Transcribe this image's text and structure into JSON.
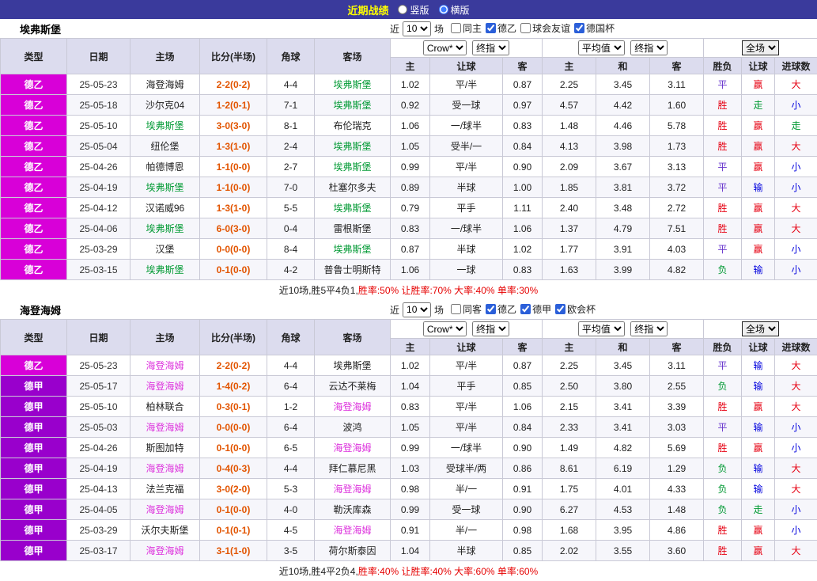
{
  "colors": {
    "accent_bar": "#3a3a9c",
    "title_text": "#ffff00",
    "header_bg": "#dcdcee",
    "score": "#e25400",
    "summary_stats": "#e60000",
    "league": {
      "德乙": "#d800d8",
      "德甲": "#9900cc"
    },
    "outcome": {
      "胜": "#e60012",
      "平": "#6633cc",
      "负": "#009933"
    },
    "handicap": {
      "赢": "#e60012",
      "输": "#0000dd",
      "走": "#009933"
    },
    "goals": {
      "大": "#e60012",
      "小": "#0000dd",
      "走": "#009933"
    }
  },
  "top_bar": {
    "title": "近期战绩",
    "radios": [
      {
        "label": "竖版",
        "checked": false
      },
      {
        "label": "横版",
        "checked": true
      }
    ]
  },
  "filter": {
    "near": "近",
    "count": "10",
    "games": "场"
  },
  "table_header": {
    "type": "类型",
    "date": "日期",
    "home": "主场",
    "score": "比分(半场)",
    "corner": "角球",
    "away": "客场",
    "odds1_selects": [
      "Crow*",
      "终指"
    ],
    "odds2_selects": [
      "平均值",
      "终指"
    ],
    "odds3_select": "全场",
    "sub1": [
      "主",
      "让球",
      "客"
    ],
    "sub2": [
      "主",
      "和",
      "客"
    ],
    "sub3": [
      "胜负",
      "让球",
      "进球数"
    ]
  },
  "sections": [
    {
      "team": "埃弗斯堡",
      "focus_color": "#009933",
      "checkboxes": [
        {
          "label": "同主",
          "checked": false
        },
        {
          "label": "德乙",
          "checked": true
        },
        {
          "label": "球会友谊",
          "checked": false
        },
        {
          "label": "德国杯",
          "checked": true
        }
      ],
      "rows": [
        {
          "league": "德乙",
          "date": "25-05-23",
          "home": "海登海姆",
          "score": "2-2(0-2)",
          "corner": "4-4",
          "away": "埃弗斯堡",
          "o1": [
            "1.02",
            "平/半",
            "0.87"
          ],
          "o2": [
            "2.25",
            "3.45",
            "3.11"
          ],
          "res": [
            "平",
            "赢",
            "大"
          ]
        },
        {
          "league": "德乙",
          "date": "25-05-18",
          "home": "沙尔克04",
          "score": "1-2(0-1)",
          "corner": "7-1",
          "away": "埃弗斯堡",
          "o1": [
            "0.92",
            "受一球",
            "0.97"
          ],
          "o2": [
            "4.57",
            "4.42",
            "1.60"
          ],
          "res": [
            "胜",
            "走",
            "小"
          ]
        },
        {
          "league": "德乙",
          "date": "25-05-10",
          "home": "埃弗斯堡",
          "score": "3-0(3-0)",
          "corner": "8-1",
          "away": "布伦瑞克",
          "o1": [
            "1.06",
            "一/球半",
            "0.83"
          ],
          "o2": [
            "1.48",
            "4.46",
            "5.78"
          ],
          "res": [
            "胜",
            "赢",
            "走"
          ]
        },
        {
          "league": "德乙",
          "date": "25-05-04",
          "home": "纽伦堡",
          "score": "1-3(1-0)",
          "corner": "2-4",
          "away": "埃弗斯堡",
          "o1": [
            "1.05",
            "受半/一",
            "0.84"
          ],
          "o2": [
            "4.13",
            "3.98",
            "1.73"
          ],
          "res": [
            "胜",
            "赢",
            "大"
          ]
        },
        {
          "league": "德乙",
          "date": "25-04-26",
          "home": "帕德博恩",
          "score": "1-1(0-0)",
          "corner": "2-7",
          "away": "埃弗斯堡",
          "o1": [
            "0.99",
            "平/半",
            "0.90"
          ],
          "o2": [
            "2.09",
            "3.67",
            "3.13"
          ],
          "res": [
            "平",
            "赢",
            "小"
          ]
        },
        {
          "league": "德乙",
          "date": "25-04-19",
          "home": "埃弗斯堡",
          "score": "1-1(0-0)",
          "corner": "7-0",
          "away": "杜塞尔多夫",
          "o1": [
            "0.89",
            "半球",
            "1.00"
          ],
          "o2": [
            "1.85",
            "3.81",
            "3.72"
          ],
          "res": [
            "平",
            "输",
            "小"
          ]
        },
        {
          "league": "德乙",
          "date": "25-04-12",
          "home": "汉诺威96",
          "score": "1-3(1-0)",
          "corner": "5-5",
          "away": "埃弗斯堡",
          "o1": [
            "0.79",
            "平手",
            "1.11"
          ],
          "o2": [
            "2.40",
            "3.48",
            "2.72"
          ],
          "res": [
            "胜",
            "赢",
            "大"
          ]
        },
        {
          "league": "德乙",
          "date": "25-04-06",
          "home": "埃弗斯堡",
          "score": "6-0(3-0)",
          "corner": "0-4",
          "away": "雷根斯堡",
          "o1": [
            "0.83",
            "一/球半",
            "1.06"
          ],
          "o2": [
            "1.37",
            "4.79",
            "7.51"
          ],
          "res": [
            "胜",
            "赢",
            "大"
          ]
        },
        {
          "league": "德乙",
          "date": "25-03-29",
          "home": "汉堡",
          "score": "0-0(0-0)",
          "corner": "8-4",
          "away": "埃弗斯堡",
          "o1": [
            "0.87",
            "半球",
            "1.02"
          ],
          "o2": [
            "1.77",
            "3.91",
            "4.03"
          ],
          "res": [
            "平",
            "赢",
            "小"
          ]
        },
        {
          "league": "德乙",
          "date": "25-03-15",
          "home": "埃弗斯堡",
          "score": "0-1(0-0)",
          "corner": "4-2",
          "away": "普鲁士明斯特",
          "o1": [
            "1.06",
            "一球",
            "0.83"
          ],
          "o2": [
            "1.63",
            "3.99",
            "4.82"
          ],
          "res": [
            "负",
            "输",
            "小"
          ]
        }
      ],
      "summary_prefix": "近10场,胜5平4负1, ",
      "summary_stats": "胜率:50% 让胜率:70% 大率:40% 单率:30%"
    },
    {
      "team": "海登海姆",
      "focus_color": "#dd33dd",
      "checkboxes": [
        {
          "label": "同客",
          "checked": false
        },
        {
          "label": "德乙",
          "checked": true
        },
        {
          "label": "德甲",
          "checked": true
        },
        {
          "label": "欧会杯",
          "checked": true
        }
      ],
      "rows": [
        {
          "league": "德乙",
          "date": "25-05-23",
          "home": "海登海姆",
          "score": "2-2(0-2)",
          "corner": "4-4",
          "away": "埃弗斯堡",
          "o1": [
            "1.02",
            "平/半",
            "0.87"
          ],
          "o2": [
            "2.25",
            "3.45",
            "3.11"
          ],
          "res": [
            "平",
            "输",
            "大"
          ]
        },
        {
          "league": "德甲",
          "date": "25-05-17",
          "home": "海登海姆",
          "score": "1-4(0-2)",
          "corner": "6-4",
          "away": "云达不莱梅",
          "o1": [
            "1.04",
            "平手",
            "0.85"
          ],
          "o2": [
            "2.50",
            "3.80",
            "2.55"
          ],
          "res": [
            "负",
            "输",
            "大"
          ]
        },
        {
          "league": "德甲",
          "date": "25-05-10",
          "home": "柏林联合",
          "score": "0-3(0-1)",
          "corner": "1-2",
          "away": "海登海姆",
          "o1": [
            "0.83",
            "平/半",
            "1.06"
          ],
          "o2": [
            "2.15",
            "3.41",
            "3.39"
          ],
          "res": [
            "胜",
            "赢",
            "大"
          ]
        },
        {
          "league": "德甲",
          "date": "25-05-03",
          "home": "海登海姆",
          "score": "0-0(0-0)",
          "corner": "6-4",
          "away": "波鸿",
          "o1": [
            "1.05",
            "平/半",
            "0.84"
          ],
          "o2": [
            "2.33",
            "3.41",
            "3.03"
          ],
          "res": [
            "平",
            "输",
            "小"
          ]
        },
        {
          "league": "德甲",
          "date": "25-04-26",
          "home": "斯图加特",
          "score": "0-1(0-0)",
          "corner": "6-5",
          "away": "海登海姆",
          "o1": [
            "0.99",
            "一/球半",
            "0.90"
          ],
          "o2": [
            "1.49",
            "4.82",
            "5.69"
          ],
          "res": [
            "胜",
            "赢",
            "小"
          ]
        },
        {
          "league": "德甲",
          "date": "25-04-19",
          "home": "海登海姆",
          "score": "0-4(0-3)",
          "corner": "4-4",
          "away": "拜仁慕尼黑",
          "o1": [
            "1.03",
            "受球半/两",
            "0.86"
          ],
          "o2": [
            "8.61",
            "6.19",
            "1.29"
          ],
          "res": [
            "负",
            "输",
            "大"
          ]
        },
        {
          "league": "德甲",
          "date": "25-04-13",
          "home": "法兰克福",
          "score": "3-0(2-0)",
          "corner": "5-3",
          "away": "海登海姆",
          "o1": [
            "0.98",
            "半/一",
            "0.91"
          ],
          "o2": [
            "1.75",
            "4.01",
            "4.33"
          ],
          "res": [
            "负",
            "输",
            "大"
          ]
        },
        {
          "league": "德甲",
          "date": "25-04-05",
          "home": "海登海姆",
          "score": "0-1(0-0)",
          "corner": "4-0",
          "away": "勒沃库森",
          "o1": [
            "0.99",
            "受一球",
            "0.90"
          ],
          "o2": [
            "6.27",
            "4.53",
            "1.48"
          ],
          "res": [
            "负",
            "走",
            "小"
          ]
        },
        {
          "league": "德甲",
          "date": "25-03-29",
          "home": "沃尔夫斯堡",
          "score": "0-1(0-1)",
          "corner": "4-5",
          "away": "海登海姆",
          "o1": [
            "0.91",
            "半/一",
            "0.98"
          ],
          "o2": [
            "1.68",
            "3.95",
            "4.86"
          ],
          "res": [
            "胜",
            "赢",
            "小"
          ]
        },
        {
          "league": "德甲",
          "date": "25-03-17",
          "home": "海登海姆",
          "score": "3-1(1-0)",
          "corner": "3-5",
          "away": "荷尔斯泰因",
          "o1": [
            "1.04",
            "半球",
            "0.85"
          ],
          "o2": [
            "2.02",
            "3.55",
            "3.60"
          ],
          "res": [
            "胜",
            "赢",
            "大"
          ]
        }
      ],
      "summary_prefix": "近10场,胜4平2负4, ",
      "summary_stats": "胜率:40% 让胜率:40% 大率:60% 单率:60%"
    }
  ]
}
